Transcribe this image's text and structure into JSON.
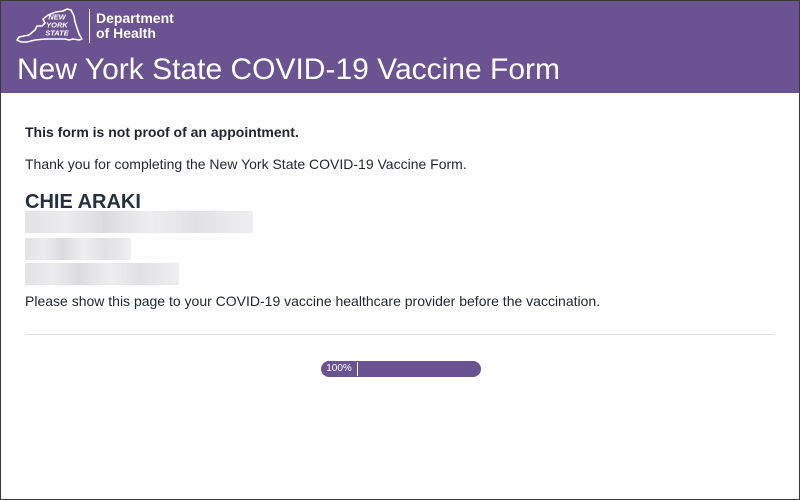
{
  "header": {
    "logo_text": [
      "NEW",
      "YORK",
      "STATE"
    ],
    "department_line1": "Department",
    "department_line2": "of Health",
    "title": "New York State COVID-19 Vaccine Form"
  },
  "main": {
    "notice": "This form is not proof of an appointment.",
    "thanks": "Thank you for completing the New York State COVID-19 Vaccine Form.",
    "name": "CHIE ARAKI",
    "instruction": "Please show this page to your COVID-19 vaccine healthcare provider before the vaccination."
  },
  "progress": {
    "label": "100%",
    "value": 1.0
  },
  "colors": {
    "brand_purple": "#6b5291",
    "text_dark": "#1f2430"
  }
}
